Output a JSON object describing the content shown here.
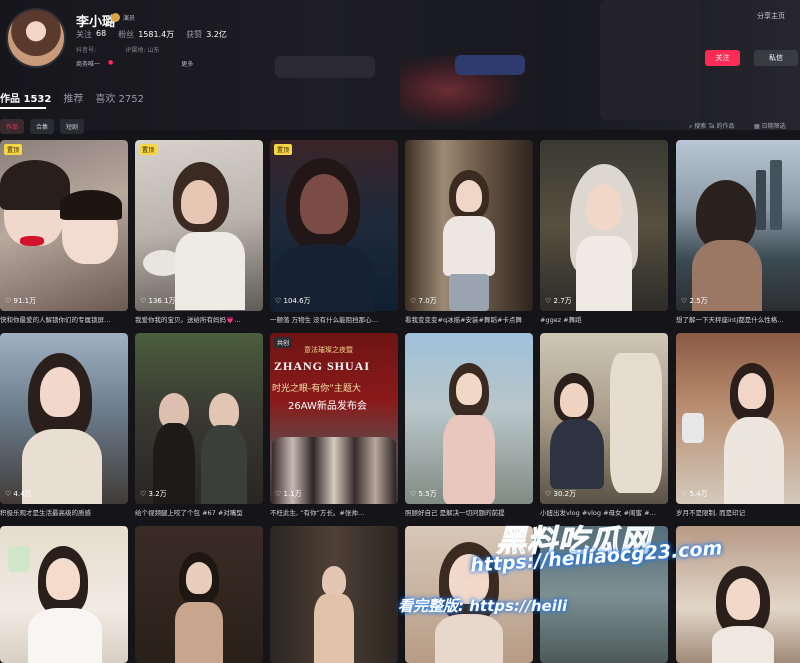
{
  "profile": {
    "name": "李小璐",
    "verified_label": "演员",
    "following_label": "关注",
    "following_count": "68",
    "fans_label": "粉丝",
    "fans_count": "1581.4万",
    "likes_label": "获赞",
    "likes_count": "3.2亿",
    "account_label": "抖音号:",
    "location_label": "IP属地: 山东",
    "business_label": "商务唯一",
    "more_label": "更多"
  },
  "header_actions": {
    "share_label": "分享主页",
    "follow_label": "关注",
    "message_label": "私信"
  },
  "tabs": [
    {
      "label": "作品 1532"
    },
    {
      "label": "推荐"
    },
    {
      "label": "喜欢 2752"
    }
  ],
  "chips": [
    {
      "label": "作品"
    },
    {
      "label": "合集"
    },
    {
      "label": "短剧"
    }
  ],
  "toolbar": {
    "search_label": "搜索 Ta 的作品",
    "sort_label": "日期筛选"
  },
  "videos": [
    {
      "pinned": "置顶",
      "likes": "91.1万",
      "caption": "快和你最爱的人解锁你们的专属锁屏…"
    },
    {
      "pinned": "置顶",
      "likes": "136.1万",
      "caption": "我爱你我的宝贝。送给所有妈妈💗…"
    },
    {
      "pinned": "置顶",
      "likes": "104.6万",
      "caption": "一颤落 万物生 没有什么能阻挡那心…"
    },
    {
      "pinned": "",
      "likes": "7.0万",
      "caption": "看我变变变#q冰摇#安装#舞蹈#卡点舞"
    },
    {
      "pinned": "",
      "likes": "2.7万",
      "caption": "#ggez #舞蹈"
    },
    {
      "pinned": "",
      "likes": "2.5万",
      "caption": "想了解一下天秤座intj都是什么性格…"
    },
    {
      "pinned": "",
      "likes": "4.4万",
      "caption": "积极乐观才是生活最高级的质感"
    },
    {
      "pinned": "",
      "likes": "3.2万",
      "caption": "给个视频腿上咬了个包 #67 #对嘴型"
    },
    {
      "pinned": "共创",
      "likes": "1.1万",
      "caption": "不枉此生, “有你”方长。#张帅…"
    },
    {
      "pinned": "",
      "likes": "5.5万",
      "caption": "照顾好自己 是解决一切问题的前提"
    },
    {
      "pinned": "",
      "likes": "30.2万",
      "caption": "小妞出发vlog #vlog #母女 #闺蜜 #…"
    },
    {
      "pinned": "",
      "likes": "5.4万",
      "caption": "岁月不是限制, 而是印记"
    },
    {
      "pinned": "",
      "likes": "",
      "caption": ""
    },
    {
      "pinned": "",
      "likes": "",
      "caption": ""
    },
    {
      "pinned": "",
      "likes": "",
      "caption": ""
    },
    {
      "pinned": "",
      "likes": "",
      "caption": ""
    },
    {
      "pinned": "",
      "likes": "",
      "caption": ""
    },
    {
      "pinned": "",
      "likes": "",
      "caption": ""
    }
  ],
  "poster_text": {
    "brand": "ZHANG SHUAI",
    "line1": "意法璀璨之夜暨",
    "line2": "时光之眼-有你”主题大",
    "line3": "26AW新品发布会"
  },
  "watermark": {
    "title": "黑料吃瓜网",
    "url": "https://heiliaocg23.com",
    "prefix": "看完整版:",
    "url_short": "https://heili"
  }
}
